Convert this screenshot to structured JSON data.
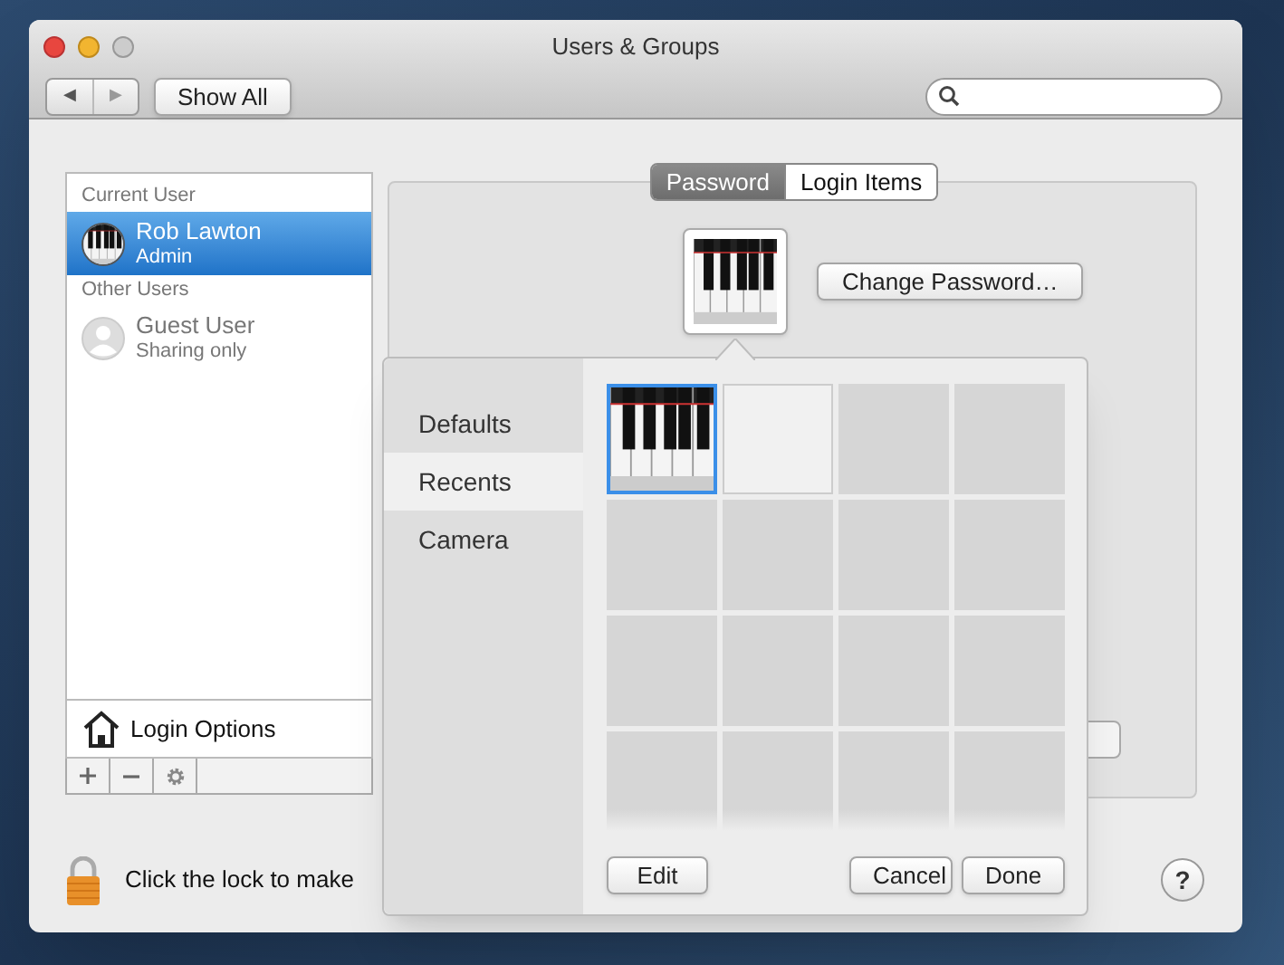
{
  "window": {
    "title": "Users & Groups"
  },
  "toolbar": {
    "back": "◀",
    "forward": "▶",
    "show_all": "Show All"
  },
  "sidebar": {
    "sections": [
      {
        "heading": "Current User",
        "users": [
          {
            "name": "Rob Lawton",
            "role": "Admin",
            "kind": "piano",
            "selected": true
          }
        ]
      },
      {
        "heading": "Other Users",
        "users": [
          {
            "name": "Guest User",
            "role": "Sharing only",
            "kind": "guest",
            "selected": false
          }
        ]
      }
    ],
    "login_options": "Login Options"
  },
  "tabs": [
    {
      "label": "Password",
      "selected": true
    },
    {
      "label": "Login Items",
      "selected": false
    }
  ],
  "change_password": "Change Password…",
  "picker": {
    "categories": [
      {
        "label": "Defaults",
        "selected": false
      },
      {
        "label": "Recents",
        "selected": true
      },
      {
        "label": "Camera",
        "selected": false
      }
    ],
    "tiles": [
      {
        "kind": "piano",
        "selected": true
      },
      {
        "kind": "empty",
        "selected": false
      }
    ],
    "edit": "Edit",
    "cancel": "Cancel",
    "done": "Done"
  },
  "lock_text": "Click the lock to make",
  "help": "?"
}
